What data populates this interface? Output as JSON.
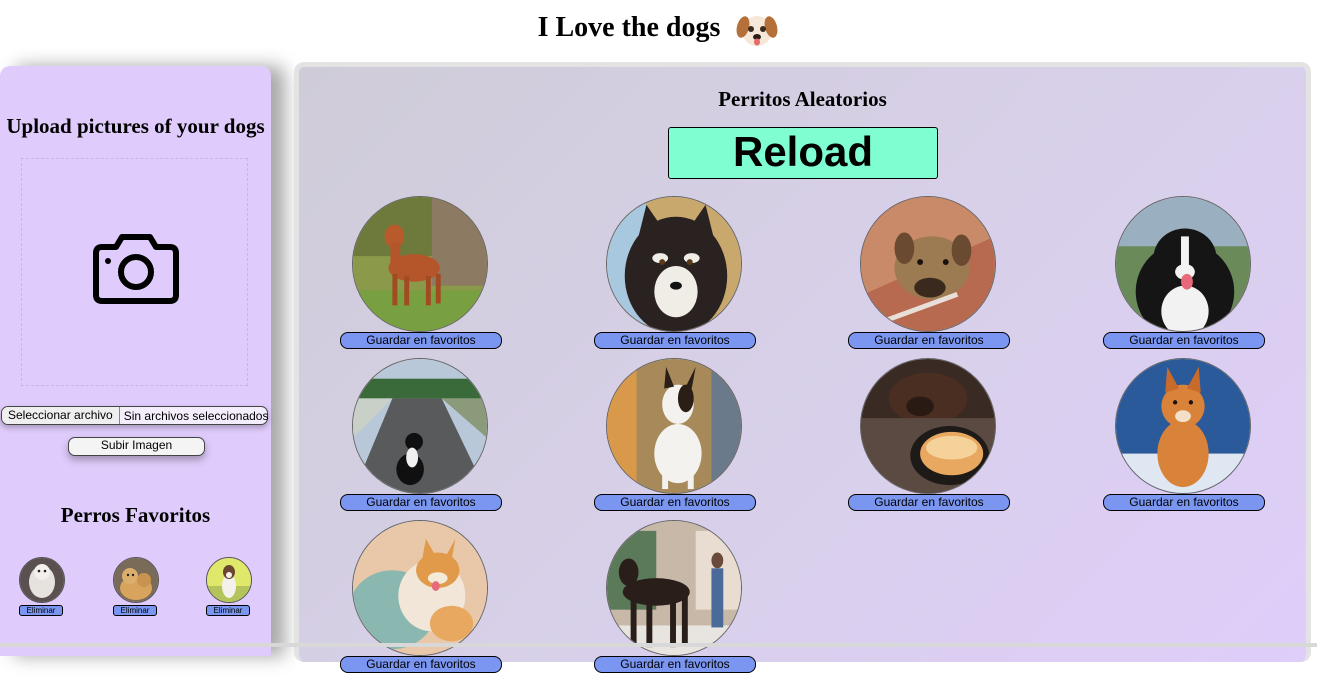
{
  "header": {
    "title": "I Love the dogs",
    "emoji_icon": "dog-face-icon"
  },
  "upload": {
    "title": "Upload pictures of your dogs",
    "drop_zone_icon": "camera-icon",
    "file_select_label": "Seleccionar archivo",
    "file_status": "Sin archivos seleccionados",
    "upload_button": "Subir Imagen"
  },
  "favorites": {
    "title": "Perros Favoritos",
    "items": [
      {
        "remove_label": "Eliminar"
      },
      {
        "remove_label": "Eliminar"
      },
      {
        "remove_label": "Eliminar"
      }
    ]
  },
  "random": {
    "title": "Perritos Aleatorios",
    "reload_label": "Reload",
    "dogs": [
      {
        "save_label": "Guardar en favoritos"
      },
      {
        "save_label": "Guardar en favoritos"
      },
      {
        "save_label": "Guardar en favoritos"
      },
      {
        "save_label": "Guardar en favoritos"
      },
      {
        "save_label": "Guardar en favoritos"
      },
      {
        "save_label": "Guardar en favoritos"
      },
      {
        "save_label": "Guardar en favoritos"
      },
      {
        "save_label": "Guardar en favoritos"
      },
      {
        "save_label": "Guardar en favoritos"
      },
      {
        "save_label": "Guardar en favoritos"
      }
    ]
  },
  "colors": {
    "left_panel_bg": "#e0ccfc",
    "reload_bg": "#7ffed2",
    "fav_button_bg": "#7a96f0"
  }
}
